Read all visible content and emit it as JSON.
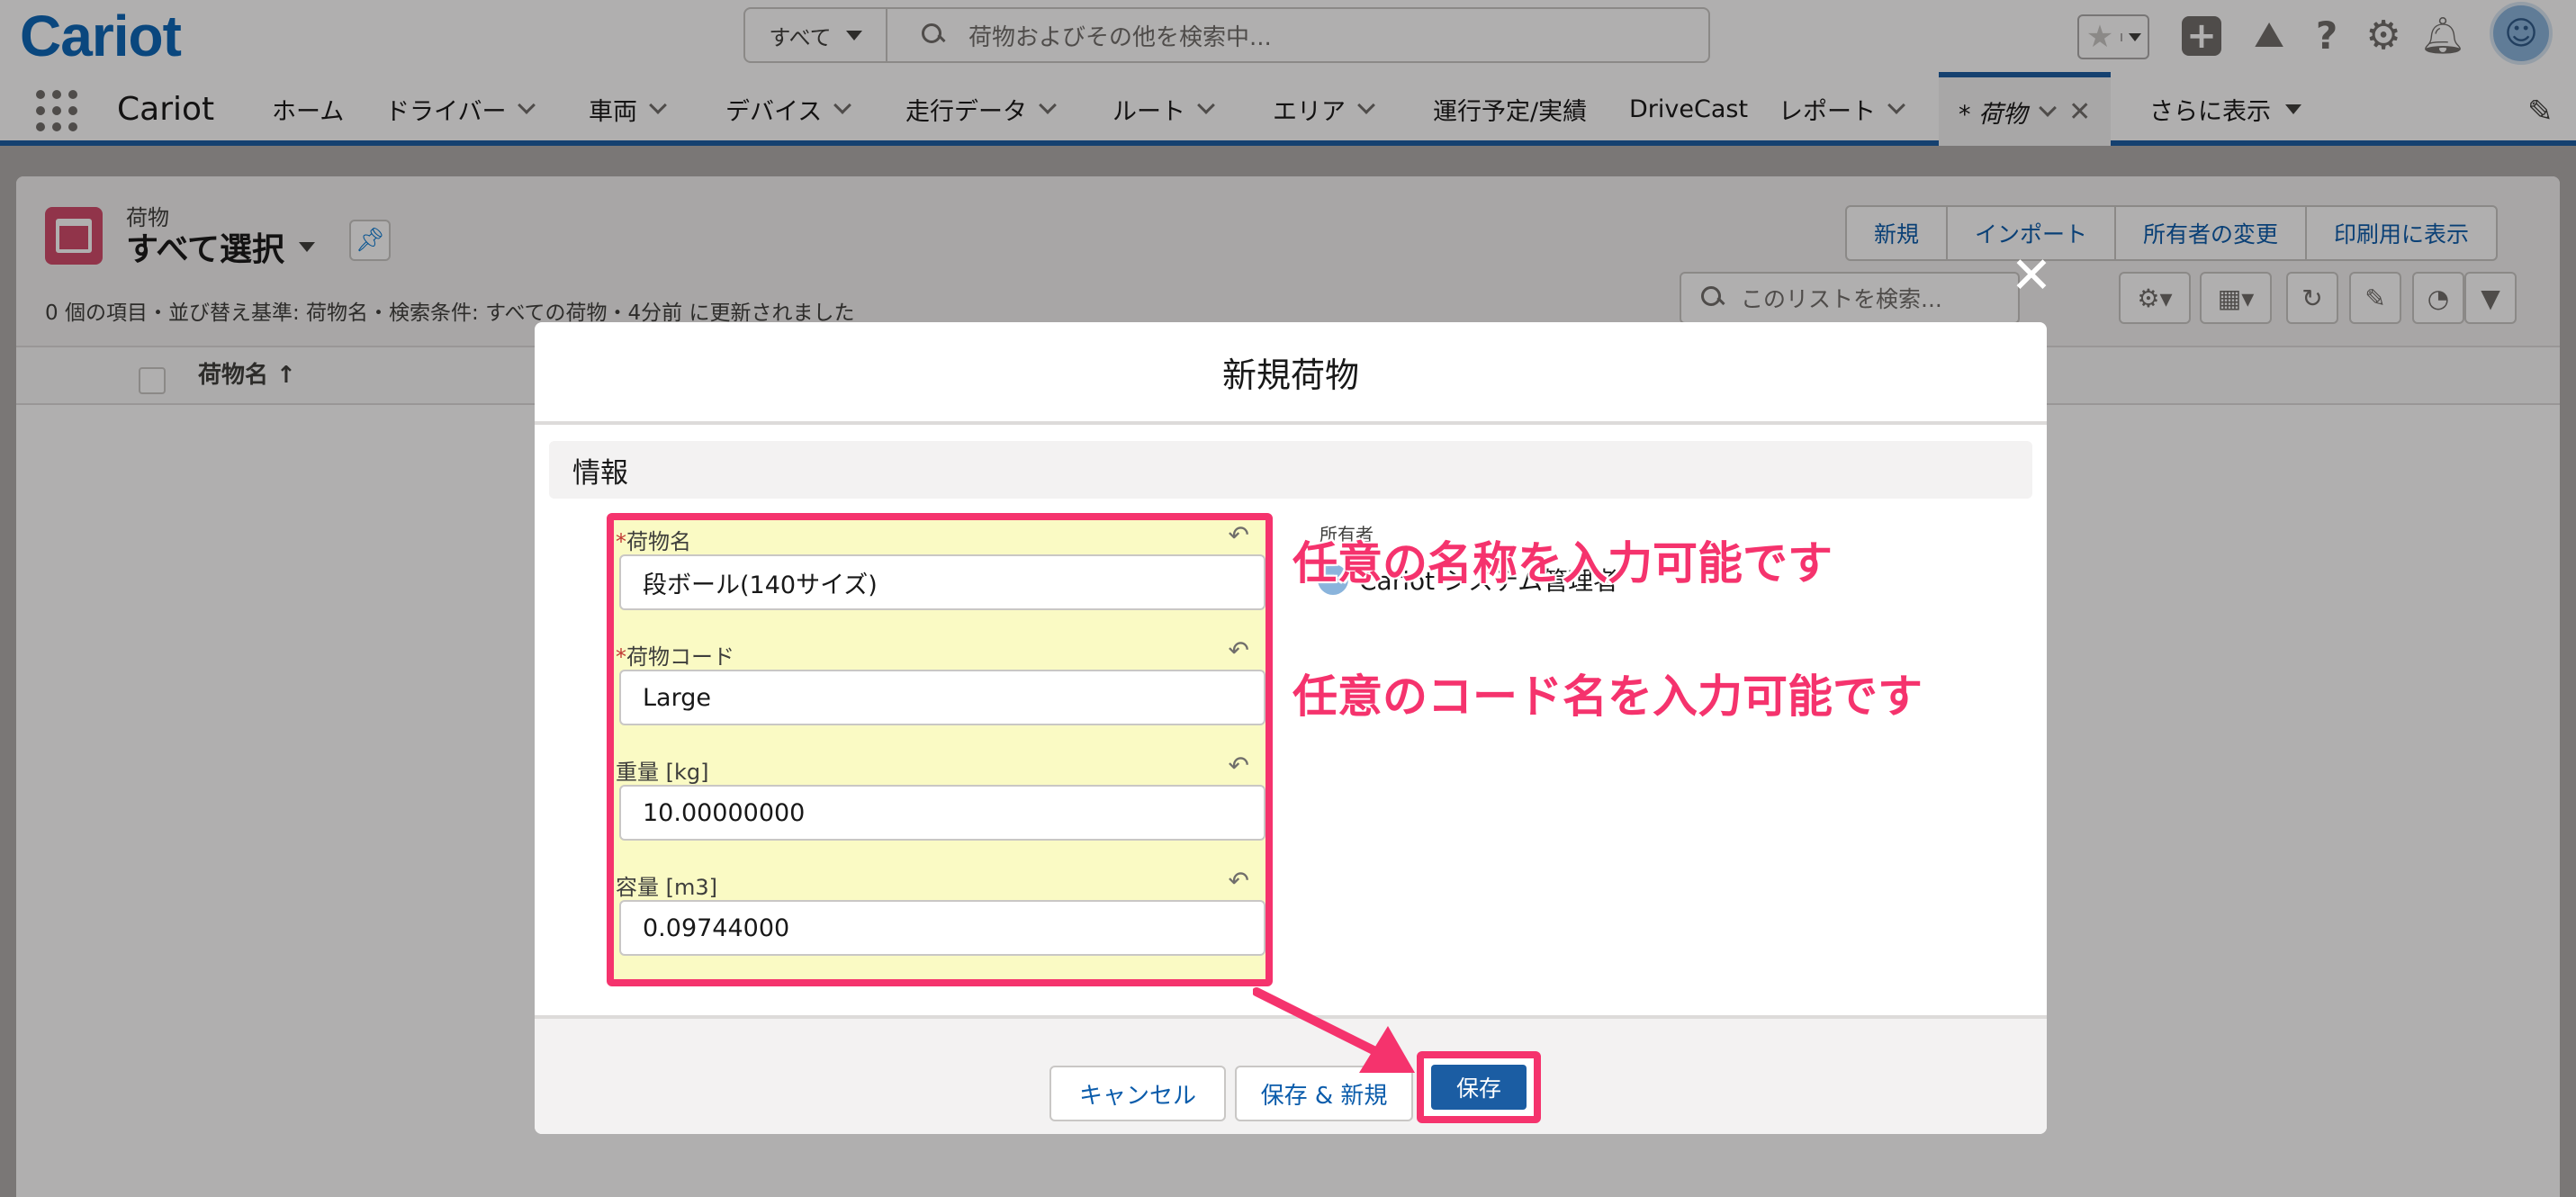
{
  "header": {
    "logo": "Cariot",
    "search_scope": "すべて",
    "search_placeholder": "荷物およびその他を検索中..."
  },
  "nav": {
    "app_name": "Cariot",
    "items": [
      {
        "label": "ホーム",
        "dropdown": false
      },
      {
        "label": "ドライバー",
        "dropdown": true
      },
      {
        "label": "車両",
        "dropdown": true
      },
      {
        "label": "デバイス",
        "dropdown": true
      },
      {
        "label": "走行データ",
        "dropdown": true
      },
      {
        "label": "ルート",
        "dropdown": true
      },
      {
        "label": "エリア",
        "dropdown": true
      },
      {
        "label": "運行予定/実績",
        "dropdown": false
      },
      {
        "label": "DriveCast",
        "dropdown": false
      },
      {
        "label": "レポート",
        "dropdown": true
      }
    ],
    "active_tab": "* 荷物",
    "more": "さらに表示"
  },
  "list_view": {
    "object_label": "荷物",
    "view_name": "すべて選択",
    "meta": "0 個の項目・並び替え基準: 荷物名・検索条件: すべての荷物・4分前 に更新されました",
    "buttons": [
      "新規",
      "インポート",
      "所有者の変更",
      "印刷用に表示"
    ],
    "search_placeholder": "このリストを検索...",
    "column": "荷物名 ↑"
  },
  "modal": {
    "title": "新規荷物",
    "section": "情報",
    "fields": [
      {
        "label": "荷物名",
        "required": true,
        "value": "段ボール(140サイズ)"
      },
      {
        "label": "荷物コード",
        "required": true,
        "value": "Large"
      },
      {
        "label": "重量 [kg]",
        "required": false,
        "value": "10.00000000"
      },
      {
        "label": "容量 [m3]",
        "required": false,
        "value": "0.09744000"
      }
    ],
    "owner_label": "所有者",
    "owner_value": "Cariot システム管理者",
    "cancel": "キャンセル",
    "save_new": "保存 & 新規",
    "save": "保存"
  },
  "annotations": {
    "name_callout": "任意の名称を入力可能です",
    "code_callout": "任意のコード名を入力可能です",
    "highlight_color": "#f5336d"
  },
  "colors": {
    "brand": "#0b66b7",
    "nav_accent": "#1b5da3",
    "object_icon": "#d24b6a"
  }
}
